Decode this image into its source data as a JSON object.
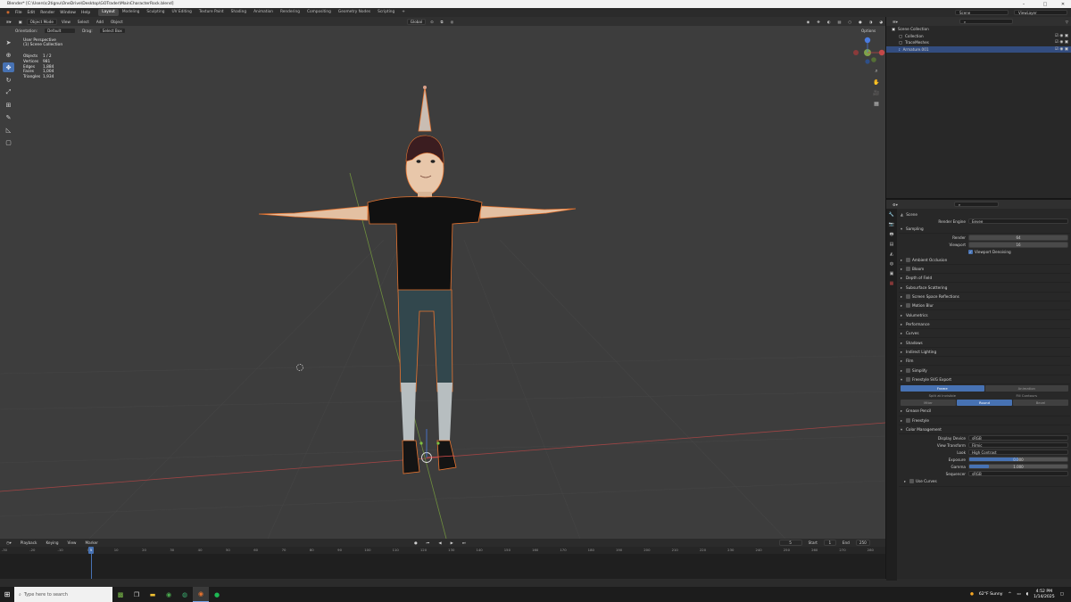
{
  "window": {
    "title": "Blender* [C:\\Users\\c2tignu\\OneDrive\\Desktop\\GOTrader\\MainCharacterRock.blend]",
    "minimize": "–",
    "maximize": "□",
    "close": "✕"
  },
  "menu": [
    "File",
    "Edit",
    "Render",
    "Window",
    "Help"
  ],
  "workspaces": [
    "Layout",
    "Modeling",
    "Sculpting",
    "UV Editing",
    "Texture Paint",
    "Shading",
    "Animation",
    "Rendering",
    "Compositing",
    "Geometry Nodes",
    "Scripting"
  ],
  "scene_selector": "Scene",
  "viewlayer_selector": "ViewLayer",
  "viewport_header": {
    "mode": "Object Mode",
    "view": "View",
    "select": "Select",
    "add": "Add",
    "object": "Object",
    "transform": "Global",
    "orientation_label": "Orientation:",
    "orientation_value": "Default",
    "drag_label": "Drag:",
    "drag_value": "Select Box",
    "options": "Options"
  },
  "overlay": {
    "perspective": "User Perspective",
    "collection": "(1) Scene Collection"
  },
  "stats": [
    {
      "k": "Objects",
      "v": "1 / 2"
    },
    {
      "k": "Vertices",
      "v": "981"
    },
    {
      "k": "Edges",
      "v": "1,884"
    },
    {
      "k": "Faces",
      "v": "1,004"
    },
    {
      "k": "Triangles",
      "v": "1,934"
    }
  ],
  "timeline": {
    "menus": [
      "Playback",
      "Keying",
      "View",
      "Marker"
    ],
    "current_frame": "5",
    "start_label": "Start",
    "start": "1",
    "end_label": "End",
    "end": "250",
    "playhead": "5",
    "ticks": [
      "-30",
      "-20",
      "-10",
      "0",
      "10",
      "20",
      "30",
      "40",
      "50",
      "60",
      "70",
      "80",
      "90",
      "100",
      "110",
      "120",
      "130",
      "140",
      "150",
      "160",
      "170",
      "180",
      "190",
      "200",
      "210",
      "220",
      "230",
      "240",
      "250",
      "260",
      "270",
      "280"
    ]
  },
  "outliner": {
    "rows": [
      {
        "label": "Scene Collection",
        "indent": 0,
        "sel": false
      },
      {
        "label": "Collection",
        "indent": 1,
        "sel": false
      },
      {
        "label": "TraceMeshes",
        "indent": 1,
        "sel": false
      },
      {
        "label": "Armature.001",
        "indent": 1,
        "sel": true
      }
    ]
  },
  "properties": {
    "scene_label": "Scene",
    "render_engine_label": "Render Engine",
    "render_engine": "Eevee",
    "sampling": "Sampling",
    "render_label": "Render",
    "render_value": "64",
    "viewport_label": "Viewport",
    "viewport_value": "16",
    "viewport_denoising": "Viewport Denoising",
    "sections": [
      "Ambient Occlusion",
      "Bloom",
      "Depth of Field",
      "Subsurface Scattering",
      "Screen Space Reflections",
      "Motion Blur",
      "Volumetrics",
      "Performance",
      "Curves",
      "Shadows",
      "Indirect Lighting",
      "Film",
      "Simplify",
      "Freestyle SVG Export"
    ],
    "svg_export_modes": [
      "Frame",
      "Animation"
    ],
    "svg_options": [
      "Split at Invisible",
      "Fill Contours"
    ],
    "svg_joins": [
      "Miter",
      "Round",
      "Bevel"
    ],
    "grease_pencil": "Grease Pencil",
    "freestyle": "Freestyle",
    "color_management": "Color Management",
    "display_device_label": "Display Device",
    "display_device": "sRGB",
    "view_transform_label": "View Transform",
    "view_transform": "Filmic",
    "look_label": "Look",
    "look": "High Contrast",
    "exposure_label": "Exposure",
    "exposure": "0.000",
    "exposure_fill": 0.5,
    "gamma_label": "Gamma",
    "gamma": "1.000",
    "gamma_fill": 0.2,
    "sequencer_label": "Sequencer",
    "sequencer": "sRGB",
    "use_curves": "Use Curves"
  },
  "taskbar": {
    "search_placeholder": "Type here to search",
    "weather": "62°F Sunny",
    "time": "4:52 PM",
    "date": "1/14/2025"
  },
  "colors": {
    "accent": "#4772b3",
    "selection_outline": "#e8742f",
    "x_axis": "#c44848",
    "y_axis": "#7fa24a"
  }
}
